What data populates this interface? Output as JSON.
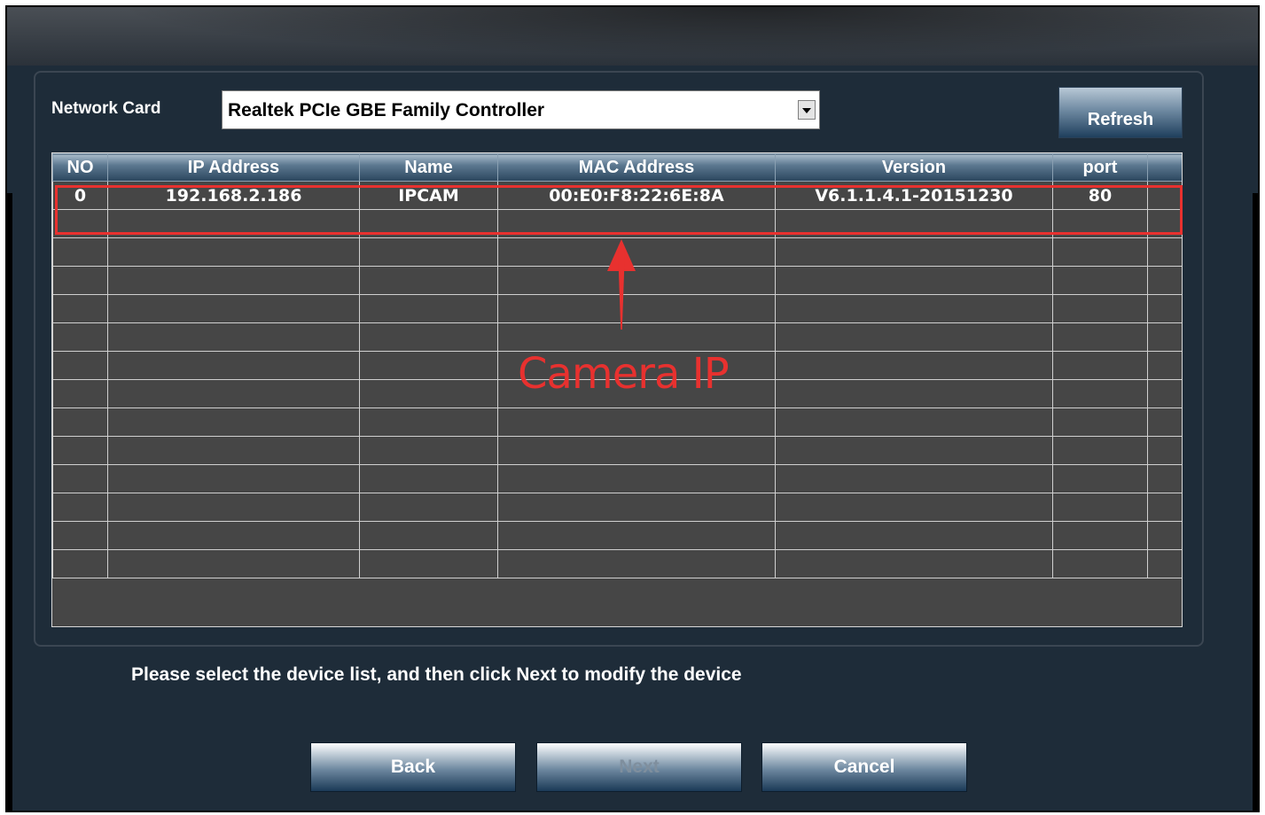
{
  "network_card": {
    "label": "Network Card",
    "selected": "Realtek PCIe GBE Family Controller"
  },
  "toolbar": {
    "refresh_label": "Refresh"
  },
  "table": {
    "columns": [
      "NO",
      "IP Address",
      "Name",
      "MAC Address",
      "Version",
      "port",
      ""
    ],
    "rows": [
      [
        "0",
        "192.168.2.186",
        "IPCAM",
        "00:E0:F8:22:6E:8A",
        "V6.1.1.4.1-20151230",
        "80",
        ""
      ]
    ],
    "empty_row_count": 13
  },
  "annotation": {
    "label": "Camera IP",
    "color": "#e8312f"
  },
  "hint": "Please select the device list, and then click Next to modify the device",
  "buttons": {
    "back": "Back",
    "next": "Next",
    "cancel": "Cancel"
  },
  "colors": {
    "background": "#1e2c39",
    "grid": "#464646",
    "highlight": "#e8312f"
  }
}
